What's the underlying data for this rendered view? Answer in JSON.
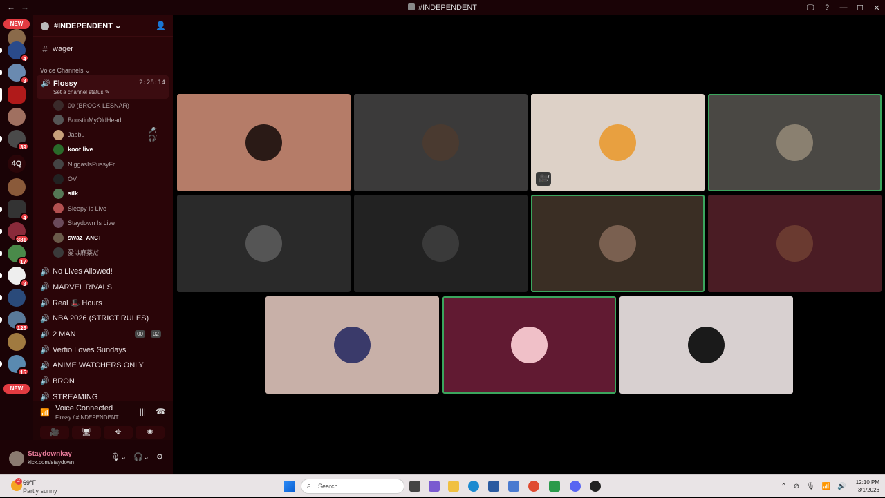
{
  "window": {
    "title": "#INDEPENDENT",
    "back": "←",
    "forward": "→",
    "controls": [
      "🖵",
      "?",
      "—",
      "☐",
      "✕"
    ]
  },
  "servers": {
    "new_top": "NEW",
    "new_bottom": "NEW",
    "text_server": "4Q",
    "badges": [
      "4",
      "3",
      "39",
      "4",
      "381",
      "17",
      "3",
      "125",
      "15"
    ]
  },
  "channel_header": {
    "server_name": "#INDEPENDENT",
    "chevron": "⌄"
  },
  "text_channels": [
    {
      "name": "wager"
    }
  ],
  "voice_category": "Voice Channels",
  "active_voice": {
    "name": "Flossy",
    "status": "Set a channel status",
    "timer": "2:28:14"
  },
  "participants": [
    {
      "name": "00 (BROCK LESNAR)",
      "bold": false,
      "color": "#3a2a2a"
    },
    {
      "name": "BoostinMyOldHead",
      "bold": false,
      "color": "#555"
    },
    {
      "name": "Jabbu",
      "bold": false,
      "color": "#c9a07a",
      "right": "🎤̸ 🎧̸"
    },
    {
      "name": "koot live",
      "bold": true,
      "color": "#2a6a2a"
    },
    {
      "name": "NiggasIsPussyFr",
      "bold": false,
      "color": "#444"
    },
    {
      "name": "OV",
      "bold": false,
      "color": "#222"
    },
    {
      "name": "silk",
      "bold": true,
      "color": "#557755"
    },
    {
      "name": "Sleepy Is Live",
      "bold": false,
      "color": "#b35050"
    },
    {
      "name": "Staydown Is Live",
      "bold": false,
      "color": "#6a4a5a"
    },
    {
      "name": "swaz",
      "bold": true,
      "color": "#6a5a4a",
      "tag": "ANCT"
    },
    {
      "name": "愛は麻薬だ",
      "bold": false,
      "color": "#3a3a3a"
    }
  ],
  "voice_channels": [
    {
      "name": "No Lives Allowed!"
    },
    {
      "name": "MARVEL RIVALS"
    },
    {
      "name": "Real 🎩 Hours"
    },
    {
      "name": "NBA 2026 (STRICT RULES)"
    },
    {
      "name": "2 MAN",
      "pills": [
        "00",
        "02"
      ]
    },
    {
      "name": "Vertio Loves Sundays"
    },
    {
      "name": "ANIME WATCHERS ONLY"
    },
    {
      "name": "BRON"
    },
    {
      "name": "STREAMING"
    }
  ],
  "voice_connected": {
    "title": "Voice Connected",
    "location": "Flossy / #INDEPENDENT"
  },
  "user": {
    "name": "Staydownkay",
    "status": "kick.com/staydown"
  },
  "tiles": [
    {
      "bg": "#b57c68",
      "avatar": "#2a1a16",
      "speaking": false
    },
    {
      "bg": "#3b3a3a",
      "avatar": "#4a3a30",
      "speaking": false
    },
    {
      "bg": "#ddd1c7",
      "avatar": "#e8a040",
      "speaking": false,
      "muted_icon": "🎥̸"
    },
    {
      "bg": "#4a4844",
      "avatar": "#8a8070",
      "speaking": true
    },
    {
      "bg": "#2a2a2a",
      "avatar": "#555",
      "speaking": false
    },
    {
      "bg": "#222222",
      "avatar": "#3a3a3a",
      "speaking": false
    },
    {
      "bg": "#3a2e24",
      "avatar": "#7a6050",
      "speaking": true
    },
    {
      "bg": "#4a1c24",
      "avatar": "#6a3a30",
      "speaking": false
    },
    {
      "bg": "#c8b0a8",
      "avatar": "#3a3a6a",
      "speaking": false
    },
    {
      "bg": "#611a32",
      "avatar": "#f0c0c8",
      "speaking": true
    },
    {
      "bg": "#d8d0d0",
      "avatar": "#1a1a1a",
      "speaking": false
    }
  ],
  "taskbar": {
    "weather_temp": "69°F",
    "weather_desc": "Partly sunny",
    "weather_badge": "2",
    "search": "Search",
    "time": "12:10 PM",
    "date": "3/1/2026"
  }
}
